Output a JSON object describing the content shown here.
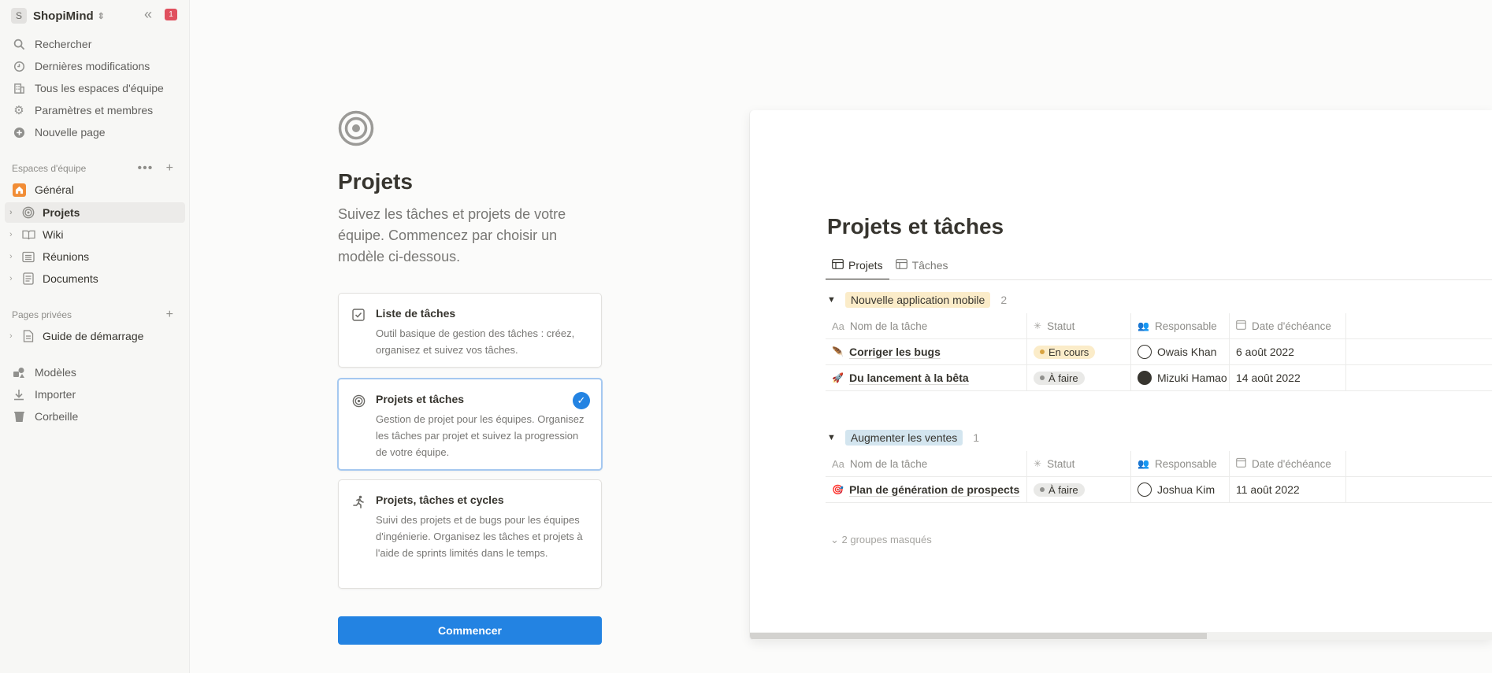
{
  "workspace": {
    "initial": "S",
    "name": "ShopiMind",
    "notification_count": "1"
  },
  "sidebar": {
    "nav": [
      {
        "label": "Rechercher",
        "icon": "search-icon"
      },
      {
        "label": "Dernières modifications",
        "icon": "clock-icon"
      },
      {
        "label": "Tous les espaces d'équipe",
        "icon": "building-icon"
      },
      {
        "label": "Paramètres et membres",
        "icon": "gear-icon"
      },
      {
        "label": "Nouvelle page",
        "icon": "plus-circle-icon"
      }
    ],
    "teamspaces_heading": "Espaces d'équipe",
    "teamspace_general": "Général",
    "team_pages": [
      {
        "label": "Projets",
        "icon": "target-icon",
        "selected": true
      },
      {
        "label": "Wiki",
        "icon": "book-icon"
      },
      {
        "label": "Réunions",
        "icon": "list-icon"
      },
      {
        "label": "Documents",
        "icon": "document-icon"
      }
    ],
    "private_heading": "Pages privées",
    "private_pages": [
      {
        "label": "Guide de démarrage",
        "icon": "document-icon"
      }
    ],
    "bottom": [
      {
        "label": "Modèles",
        "icon": "shapes-icon"
      },
      {
        "label": "Importer",
        "icon": "download-icon"
      },
      {
        "label": "Corbeille",
        "icon": "trash-icon"
      }
    ]
  },
  "onboarding": {
    "title": "Projets",
    "description": "Suivez les tâches et projets de votre équipe. Commencez par choisir un modèle ci-dessous.",
    "cards": [
      {
        "title": "Liste de tâches",
        "description": "Outil basique de gestion des tâches : créez, organisez et suivez vos tâches.",
        "icon": "checkbox-icon",
        "selected": false
      },
      {
        "title": "Projets et tâches",
        "description": "Gestion de projet pour les équipes. Organisez les tâches par projet et suivez la progression de votre équipe.",
        "icon": "target-icon",
        "selected": true
      },
      {
        "title": "Projets, tâches et cycles",
        "description": "Suivi des projets et de bugs pour les équipes d'ingénierie. Organisez les tâches et projets à l'aide de sprints limités dans le temps.",
        "icon": "running-icon",
        "selected": false
      }
    ],
    "start_button": "Commencer"
  },
  "preview": {
    "title": "Projets et tâches",
    "tabs": [
      {
        "label": "Projets",
        "active": true
      },
      {
        "label": "Tâches",
        "active": false
      }
    ],
    "columns": [
      "Nom de la tâche",
      "Statut",
      "Responsable",
      "Date d'échéance"
    ],
    "column_prefix": "Aa",
    "groups": [
      {
        "name": "Nouvelle application mobile",
        "count": "2",
        "tag_color": "#fbecc9",
        "rows": [
          {
            "name": "Corriger les bugs",
            "emoji": "🪶",
            "status": "En cours",
            "status_color": "#fbecc9",
            "status_dot": "#d9a441",
            "assignee": "Owais Khan",
            "due": "6 août 2022"
          },
          {
            "name": "Du lancement à la bêta",
            "emoji": "🚀",
            "status": "À faire",
            "status_color": "#e9e9e7",
            "status_dot": "#91918e",
            "assignee": "Mizuki Hamao",
            "due": "14 août 2022"
          }
        ]
      },
      {
        "name": "Augmenter les ventes",
        "count": "1",
        "tag_color": "#d3e5ef",
        "rows": [
          {
            "name": "Plan de génération de prospects",
            "emoji": "🎯",
            "status": "À faire",
            "status_color": "#e9e9e7",
            "status_dot": "#91918e",
            "assignee": "Joshua Kim",
            "due": "11 août 2022"
          }
        ]
      }
    ],
    "hidden_groups": "2 groupes masqués"
  }
}
